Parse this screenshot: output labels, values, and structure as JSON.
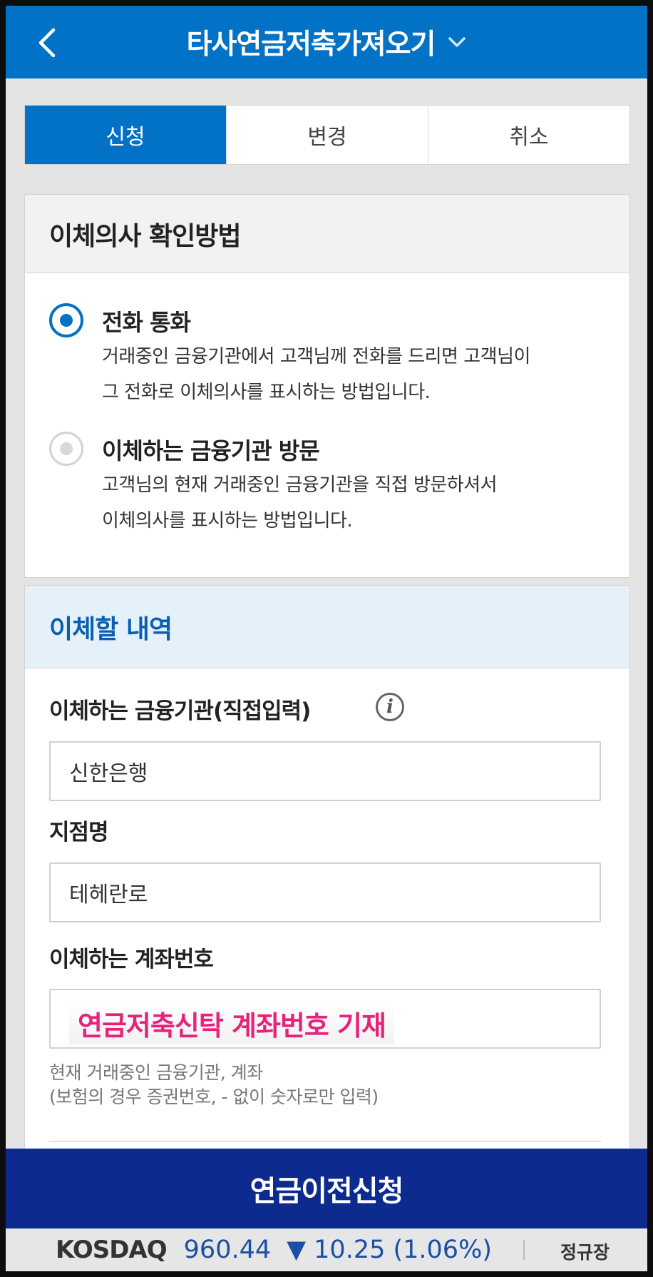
{
  "header": {
    "title": "타사연금저축가져오기",
    "back_icon": "chevron-left-icon",
    "dropdown_icon": "chevron-down-icon"
  },
  "tabs": [
    {
      "label": "신청",
      "active": true
    },
    {
      "label": "변경",
      "active": false
    },
    {
      "label": "취소",
      "active": false
    }
  ],
  "method": {
    "title": "이체의사 확인방법",
    "options": [
      {
        "title": "전화 통화",
        "line1": "거래중인 금융기관에서 고객님께 전화를 드리면 고객님이",
        "line2": "그 전화로 이체의사를 표시하는 방법입니다.",
        "selected": true
      },
      {
        "title": "이체하는 금융기관 방문",
        "line1": "고객님의 현재 거래중인 금융기관을 직접 방문하셔서",
        "line2": "이체의사를 표시하는 방법입니다.",
        "selected": false
      }
    ]
  },
  "transfer": {
    "title": "이체할 내역",
    "institution_label": "이체하는 금융기관(직접입력)",
    "institution_value": "신한은행",
    "branch_label": "지점명",
    "branch_value": "테헤란로",
    "account_label": "이체하는 계좌번호",
    "account_annotation": "연금저축신탁 계좌번호 기재",
    "hint_line1": "현재 거래중인 금융기관, 계좌",
    "hint_line2": "(보험의 경우 증권번호, - 없이 숫자로만 입력)"
  },
  "submit_label": "연금이전신청",
  "ticker": {
    "name": "KOSDAQ",
    "value": "960.44",
    "change": "▼ 10.25 (1.06%)",
    "market_status": "정규장",
    "color": "#1a4fa3"
  },
  "colors": {
    "primary": "#0272c6",
    "submit": "#0d2b8f",
    "annotation": "#e8217a"
  }
}
